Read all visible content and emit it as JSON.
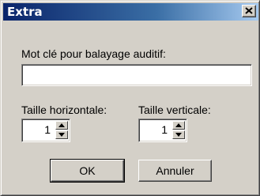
{
  "window": {
    "title": "Extra"
  },
  "icons": {
    "close": "close-icon",
    "spin_up": "arrow-up-icon",
    "spin_down": "arrow-down-icon"
  },
  "form": {
    "keyword_label": "Mot clé pour balayage auditif:",
    "keyword_value": "",
    "horizontal_label": "Taille horizontale:",
    "horizontal_value": "1",
    "vertical_label": "Taille verticale:",
    "vertical_value": "1"
  },
  "buttons": {
    "ok": "OK",
    "cancel": "Annuler"
  }
}
